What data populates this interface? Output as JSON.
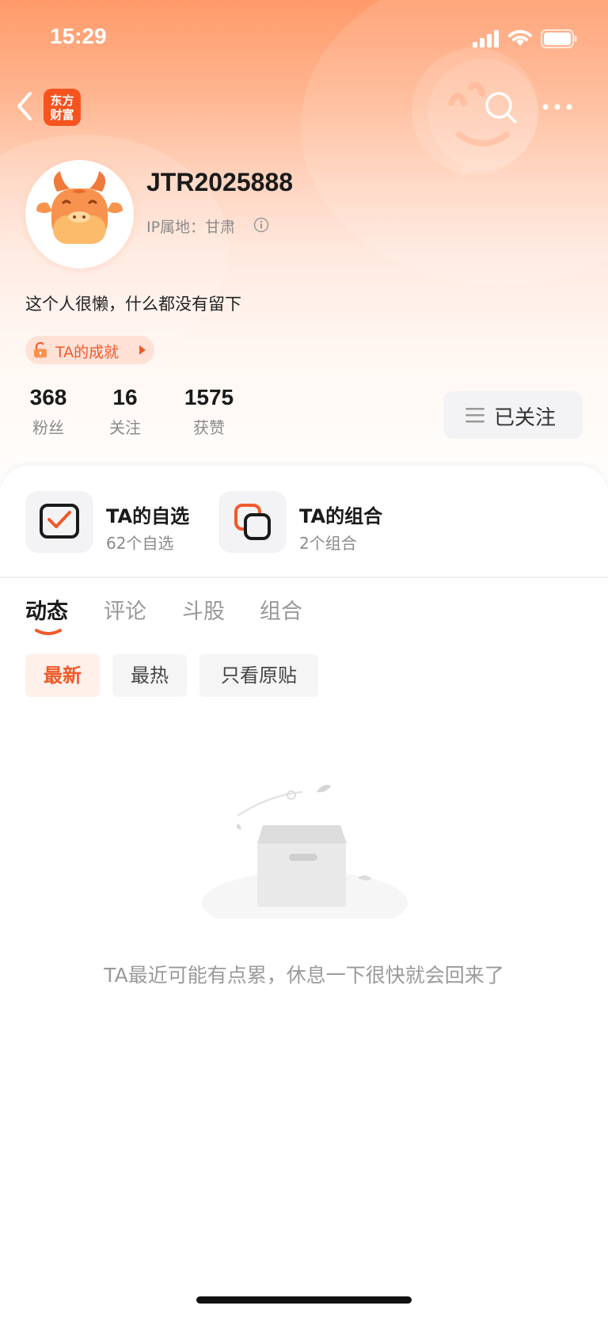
{
  "status_bar": {
    "time": "15:29"
  },
  "nav": {
    "logo_line1": "东方",
    "logo_line2": "财富"
  },
  "profile": {
    "username": "JTR2025888",
    "ip_location": "IP属地：甘肃",
    "bio": "这个人很懒，什么都没有留下",
    "achievement_label": "TA的成就"
  },
  "stats": [
    {
      "value": "368",
      "label": "粉丝"
    },
    {
      "value": "16",
      "label": "关注"
    },
    {
      "value": "1575",
      "label": "获赞"
    }
  ],
  "follow_button": {
    "label": "已关注"
  },
  "shortcuts": [
    {
      "title": "TA的自选",
      "subtitle": "62个自选",
      "icon": "watchlist-check-icon"
    },
    {
      "title": "TA的组合",
      "subtitle": "2个组合",
      "icon": "portfolio-stack-icon"
    }
  ],
  "tabs": [
    {
      "label": "动态",
      "active": true
    },
    {
      "label": "评论",
      "active": false
    },
    {
      "label": "斗股",
      "active": false
    },
    {
      "label": "组合",
      "active": false
    }
  ],
  "filters": [
    {
      "label": "最新",
      "active": true
    },
    {
      "label": "最热",
      "active": false
    },
    {
      "label": "只看原贴",
      "active": false
    }
  ],
  "empty_state": {
    "message": "TA最近可能有点累，休息一下很快就会回来了"
  },
  "colors": {
    "accent": "#ef5a2a",
    "brand": "#f5541f"
  }
}
